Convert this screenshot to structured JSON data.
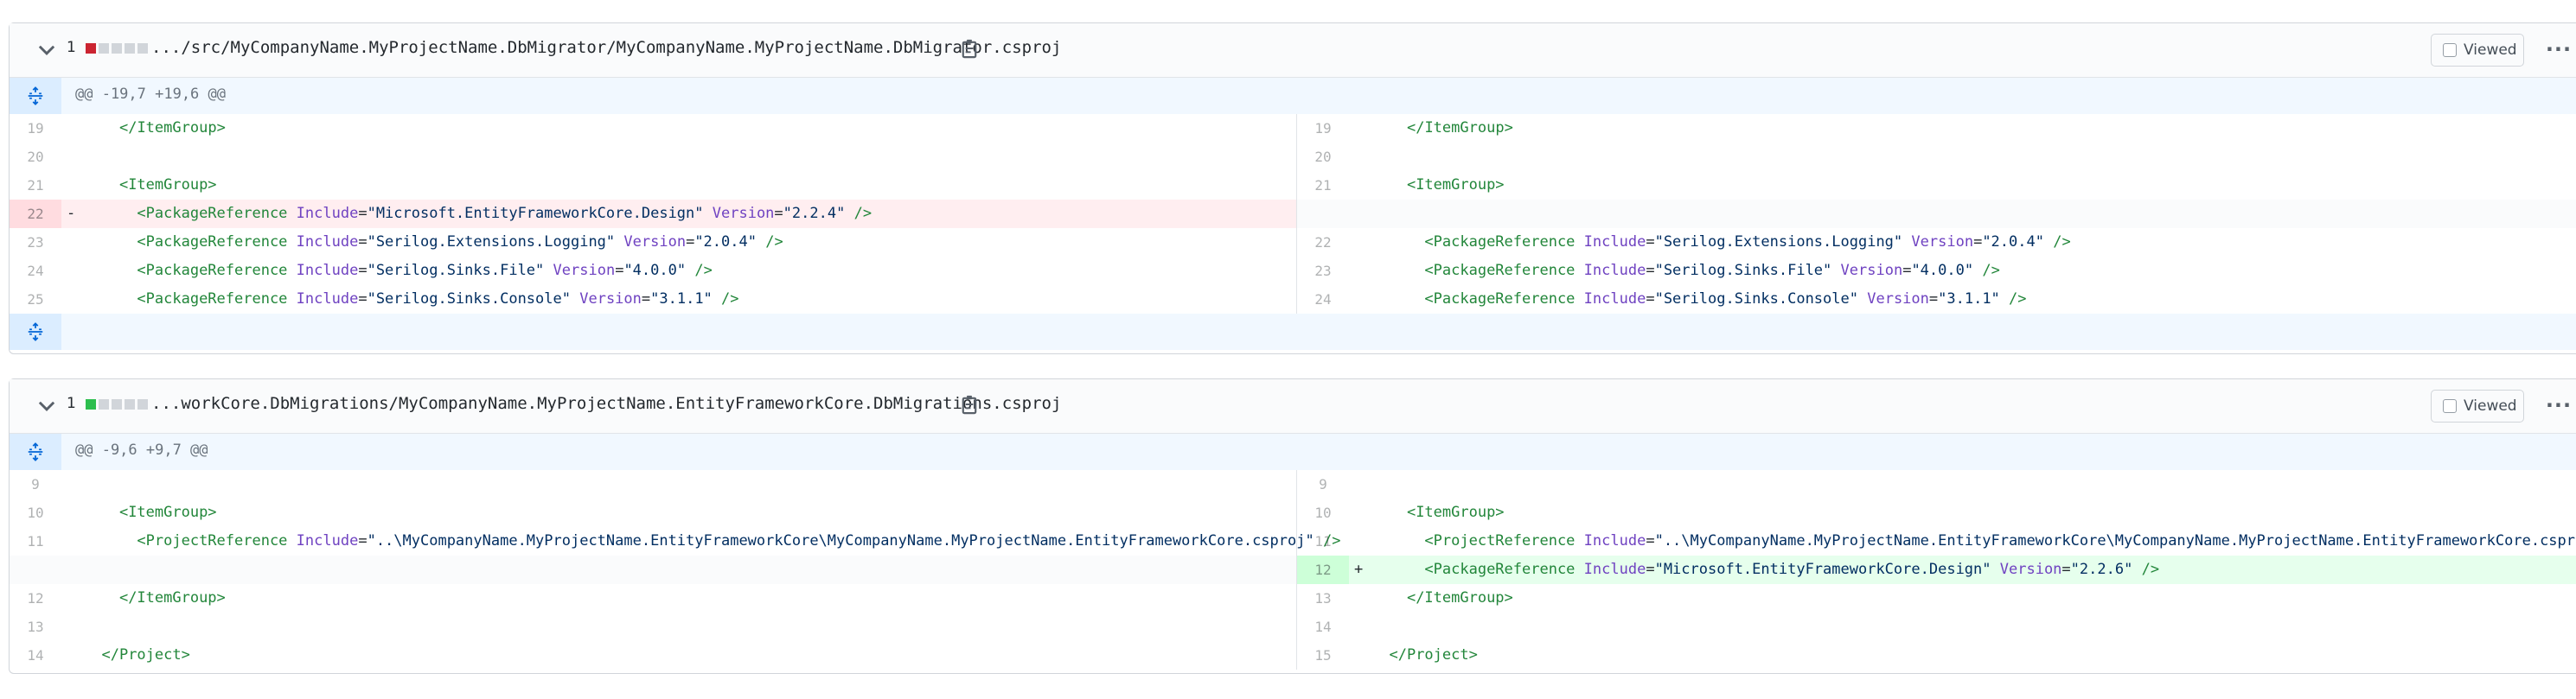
{
  "files": [
    {
      "id": "file1",
      "changes": "1",
      "diffstat": [
        "del",
        "neutral",
        "neutral",
        "neutral",
        "neutral"
      ],
      "path": ".../src/MyCompanyName.MyProjectName.DbMigrator/MyCompanyName.MyProjectName.DbMigrator.csproj",
      "viewed_label": "Viewed",
      "more_label": "···",
      "hunk_header": "@@ -19,7 +19,6 @@",
      "rows": [
        {
          "left": {
            "num": "19",
            "type": "ctx",
            "sign": "",
            "code": [
              [
                "    ",
                ""
              ],
              [
                "</",
                "t"
              ],
              [
                "ItemGroup",
                "t"
              ],
              [
                ">",
                "t"
              ]
            ]
          },
          "right": {
            "num": "19",
            "type": "ctx",
            "sign": "",
            "code": [
              [
                "    ",
                ""
              ],
              [
                "</",
                "t"
              ],
              [
                "ItemGroup",
                "t"
              ],
              [
                ">",
                "t"
              ]
            ]
          }
        },
        {
          "left": {
            "num": "20",
            "type": "ctx",
            "sign": "",
            "code": []
          },
          "right": {
            "num": "20",
            "type": "ctx",
            "sign": "",
            "code": []
          }
        },
        {
          "left": {
            "num": "21",
            "type": "ctx",
            "sign": "",
            "code": [
              [
                "    ",
                ""
              ],
              [
                "<ItemGroup>",
                "t"
              ]
            ]
          },
          "right": {
            "num": "21",
            "type": "ctx",
            "sign": "",
            "code": [
              [
                "    ",
                ""
              ],
              [
                "<ItemGroup>",
                "t"
              ]
            ]
          }
        },
        {
          "left": {
            "num": "22",
            "type": "del",
            "sign": "-",
            "code": [
              [
                "      ",
                ""
              ],
              [
                "<PackageReference",
                "t"
              ],
              [
                " ",
                ""
              ],
              [
                "Include",
                "a"
              ],
              [
                "=",
                ""
              ],
              [
                "\"Microsoft.EntityFrameworkCore.Design\"",
                "s"
              ],
              [
                " ",
                ""
              ],
              [
                "Version",
                "a"
              ],
              [
                "=",
                ""
              ],
              [
                "\"2.2.4\"",
                "s"
              ],
              [
                " ",
                ""
              ],
              [
                "/>",
                "t"
              ]
            ]
          },
          "right": {
            "num": "",
            "type": "empty",
            "sign": "",
            "code": []
          }
        },
        {
          "left": {
            "num": "23",
            "type": "ctx",
            "sign": "",
            "code": [
              [
                "      ",
                ""
              ],
              [
                "<PackageReference",
                "t"
              ],
              [
                " ",
                ""
              ],
              [
                "Include",
                "a"
              ],
              [
                "=",
                ""
              ],
              [
                "\"Serilog.Extensions.Logging\"",
                "s"
              ],
              [
                " ",
                ""
              ],
              [
                "Version",
                "a"
              ],
              [
                "=",
                ""
              ],
              [
                "\"2.0.4\"",
                "s"
              ],
              [
                " ",
                ""
              ],
              [
                "/>",
                "t"
              ]
            ]
          },
          "right": {
            "num": "22",
            "type": "ctx",
            "sign": "",
            "code": [
              [
                "      ",
                ""
              ],
              [
                "<PackageReference",
                "t"
              ],
              [
                " ",
                ""
              ],
              [
                "Include",
                "a"
              ],
              [
                "=",
                ""
              ],
              [
                "\"Serilog.Extensions.Logging\"",
                "s"
              ],
              [
                " ",
                ""
              ],
              [
                "Version",
                "a"
              ],
              [
                "=",
                ""
              ],
              [
                "\"2.0.4\"",
                "s"
              ],
              [
                " ",
                ""
              ],
              [
                "/>",
                "t"
              ]
            ]
          }
        },
        {
          "left": {
            "num": "24",
            "type": "ctx",
            "sign": "",
            "code": [
              [
                "      ",
                ""
              ],
              [
                "<PackageReference",
                "t"
              ],
              [
                " ",
                ""
              ],
              [
                "Include",
                "a"
              ],
              [
                "=",
                ""
              ],
              [
                "\"Serilog.Sinks.File\"",
                "s"
              ],
              [
                " ",
                ""
              ],
              [
                "Version",
                "a"
              ],
              [
                "=",
                ""
              ],
              [
                "\"4.0.0\"",
                "s"
              ],
              [
                " ",
                ""
              ],
              [
                "/>",
                "t"
              ]
            ]
          },
          "right": {
            "num": "23",
            "type": "ctx",
            "sign": "",
            "code": [
              [
                "      ",
                ""
              ],
              [
                "<PackageReference",
                "t"
              ],
              [
                " ",
                ""
              ],
              [
                "Include",
                "a"
              ],
              [
                "=",
                ""
              ],
              [
                "\"Serilog.Sinks.File\"",
                "s"
              ],
              [
                " ",
                ""
              ],
              [
                "Version",
                "a"
              ],
              [
                "=",
                ""
              ],
              [
                "\"4.0.0\"",
                "s"
              ],
              [
                " ",
                ""
              ],
              [
                "/>",
                "t"
              ]
            ]
          }
        },
        {
          "left": {
            "num": "25",
            "type": "ctx",
            "sign": "",
            "code": [
              [
                "      ",
                ""
              ],
              [
                "<PackageReference",
                "t"
              ],
              [
                " ",
                ""
              ],
              [
                "Include",
                "a"
              ],
              [
                "=",
                ""
              ],
              [
                "\"Serilog.Sinks.Console\"",
                "s"
              ],
              [
                " ",
                ""
              ],
              [
                "Version",
                "a"
              ],
              [
                "=",
                ""
              ],
              [
                "\"3.1.1\"",
                "s"
              ],
              [
                " ",
                ""
              ],
              [
                "/>",
                "t"
              ]
            ]
          },
          "right": {
            "num": "24",
            "type": "ctx",
            "sign": "",
            "code": [
              [
                "      ",
                ""
              ],
              [
                "<PackageReference",
                "t"
              ],
              [
                " ",
                ""
              ],
              [
                "Include",
                "a"
              ],
              [
                "=",
                ""
              ],
              [
                "\"Serilog.Sinks.Console\"",
                "s"
              ],
              [
                " ",
                ""
              ],
              [
                "Version",
                "a"
              ],
              [
                "=",
                ""
              ],
              [
                "\"3.1.1\"",
                "s"
              ],
              [
                " ",
                ""
              ],
              [
                "/>",
                "t"
              ]
            ]
          }
        }
      ],
      "has_bottom_expander": true
    },
    {
      "id": "file2",
      "changes": "1",
      "diffstat": [
        "add",
        "neutral",
        "neutral",
        "neutral",
        "neutral"
      ],
      "path": "...workCore.DbMigrations/MyCompanyName.MyProjectName.EntityFrameworkCore.DbMigrations.csproj",
      "viewed_label": "Viewed",
      "more_label": "···",
      "hunk_header": "@@ -9,6 +9,7 @@",
      "rows": [
        {
          "left": {
            "num": "9",
            "type": "ctx",
            "sign": "",
            "code": []
          },
          "right": {
            "num": "9",
            "type": "ctx",
            "sign": "",
            "code": []
          }
        },
        {
          "left": {
            "num": "10",
            "type": "ctx",
            "sign": "",
            "code": [
              [
                "    ",
                ""
              ],
              [
                "<ItemGroup>",
                "t"
              ]
            ]
          },
          "right": {
            "num": "10",
            "type": "ctx",
            "sign": "",
            "code": [
              [
                "    ",
                ""
              ],
              [
                "<ItemGroup>",
                "t"
              ]
            ]
          }
        },
        {
          "left": {
            "num": "11",
            "type": "ctx",
            "sign": "",
            "code": [
              [
                "      ",
                ""
              ],
              [
                "<ProjectReference",
                "t"
              ],
              [
                " ",
                ""
              ],
              [
                "Include",
                "a"
              ],
              [
                "=",
                ""
              ],
              [
                "\"..\\MyCompanyName.MyProjectName.EntityFrameworkCore\\MyCompanyName.MyProjectName.EntityFrameworkCore.csproj\"",
                "s"
              ],
              [
                " ",
                ""
              ],
              [
                "/>",
                "t"
              ]
            ]
          },
          "right": {
            "num": "11",
            "type": "ctx",
            "sign": "",
            "code": [
              [
                "      ",
                ""
              ],
              [
                "<ProjectReference",
                "t"
              ],
              [
                " ",
                ""
              ],
              [
                "Include",
                "a"
              ],
              [
                "=",
                ""
              ],
              [
                "\"..\\MyCompanyName.MyProjectName.EntityFrameworkCore\\MyCompanyName.MyProjectName.EntityFrameworkCore.csproj\"",
                "s"
              ],
              [
                " ",
                ""
              ],
              [
                "/>",
                "t"
              ]
            ]
          }
        },
        {
          "left": {
            "num": "",
            "type": "empty",
            "sign": "",
            "code": []
          },
          "right": {
            "num": "12",
            "type": "add",
            "sign": "+",
            "code": [
              [
                "      ",
                ""
              ],
              [
                "<PackageReference",
                "t"
              ],
              [
                " ",
                ""
              ],
              [
                "Include",
                "a"
              ],
              [
                "=",
                ""
              ],
              [
                "\"Microsoft.EntityFrameworkCore.Design\"",
                "s"
              ],
              [
                " ",
                ""
              ],
              [
                "Version",
                "a"
              ],
              [
                "=",
                ""
              ],
              [
                "\"2.2.6\"",
                "s"
              ],
              [
                " ",
                ""
              ],
              [
                "/>",
                "t"
              ]
            ]
          }
        },
        {
          "left": {
            "num": "12",
            "type": "ctx",
            "sign": "",
            "code": [
              [
                "    ",
                ""
              ],
              [
                "</ItemGroup>",
                "t"
              ]
            ]
          },
          "right": {
            "num": "13",
            "type": "ctx",
            "sign": "",
            "code": [
              [
                "    ",
                ""
              ],
              [
                "</ItemGroup>",
                "t"
              ]
            ]
          }
        },
        {
          "left": {
            "num": "13",
            "type": "ctx",
            "sign": "",
            "code": []
          },
          "right": {
            "num": "14",
            "type": "ctx",
            "sign": "",
            "code": []
          }
        },
        {
          "left": {
            "num": "14",
            "type": "ctx",
            "sign": "",
            "code": [
              [
                "  ",
                ""
              ],
              [
                "</Project>",
                "t"
              ]
            ]
          },
          "right": {
            "num": "15",
            "type": "ctx",
            "sign": "",
            "code": [
              [
                "  ",
                ""
              ],
              [
                "</Project>",
                "t"
              ]
            ]
          }
        }
      ],
      "has_bottom_expander": false
    }
  ],
  "icons": {
    "chevron": "chevron-down-icon",
    "copy": "copy-path-icon",
    "expand": "unfold-icon",
    "more": "kebab-icon"
  },
  "colors": {
    "del_bg": "#ffeef0",
    "del_num_bg": "#ffdce0",
    "add_bg": "#e6ffed",
    "add_num_bg": "#cdffd8",
    "hunk_bg": "#f1f8ff",
    "diffstat_del": "#cb2431",
    "diffstat_add": "#2cbe4e"
  }
}
